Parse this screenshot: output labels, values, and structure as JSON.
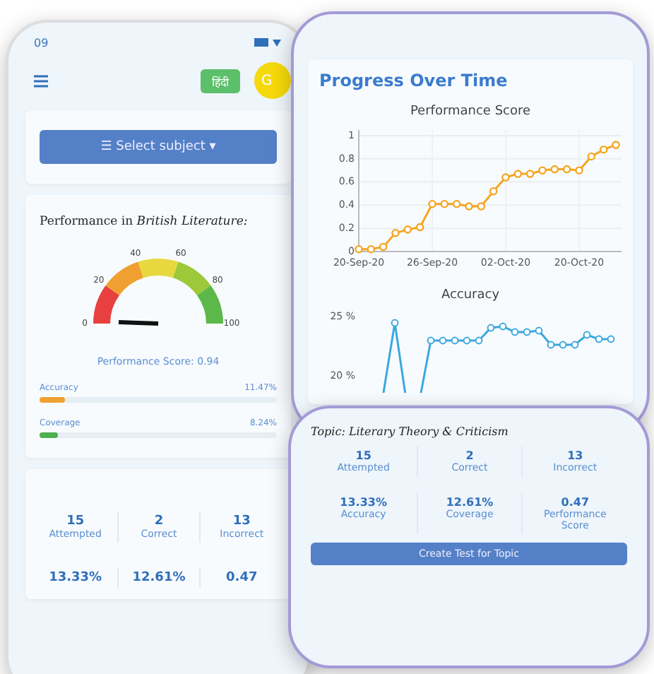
{
  "left_phone": {
    "status_time": "09",
    "language_button": "हिंदी",
    "avatar": "G",
    "subject_button": "Select subject",
    "subject_icon": "☰",
    "subject_caret": "▾",
    "title_prefix": "Performance in ",
    "subject": "British Literature:",
    "gauge": {
      "ticks": [
        "0",
        "20",
        "40",
        "60",
        "80",
        "100"
      ],
      "caption": "Performance Score: 0.94"
    },
    "bars": [
      {
        "label": "Accuracy",
        "reading": "11.47%",
        "level": 0.11,
        "color": "#f0a030"
      },
      {
        "label": "Coverage",
        "reading": "8.24%",
        "level": 0.08,
        "color": "#4cb050"
      }
    ],
    "stats": [
      {
        "value": "15",
        "label": "Attempted"
      },
      {
        "value": "2",
        "label": "Correct"
      },
      {
        "value": "13",
        "label": "Incorrect"
      },
      {
        "value": "13.33%"
      },
      {
        "value": "12.61%"
      },
      {
        "value": "0.47"
      }
    ]
  },
  "right_phone": {
    "title": "Progress Over Time",
    "charts": [
      {
        "chart_data": {
          "type": "line",
          "title": "Performance Score",
          "categories": [
            "20-Sep-20",
            null,
            null,
            null,
            null,
            null,
            "26-Sep-20",
            null,
            null,
            null,
            null,
            null,
            "02-Oct-20",
            null,
            null,
            null,
            null,
            null,
            "20-Oct-20",
            null,
            null,
            null
          ],
          "yticks": [
            0,
            0.2,
            0.4,
            0.6,
            0.8,
            1
          ],
          "ylim": [
            0,
            1
          ],
          "grid": true,
          "series": [
            {
              "color": "#f5a623",
              "marker": "o",
              "values": [
                0.02,
                0.02,
                0.04,
                0.16,
                0.19,
                0.21,
                0.41,
                0.41,
                0.41,
                0.39,
                0.39,
                0.52,
                0.64,
                0.67,
                0.67,
                0.7,
                0.71,
                0.71,
                0.7,
                0.82,
                0.88,
                0.92
              ]
            }
          ]
        }
      }
    ],
    "accuracy": {
      "title": "Accuracy",
      "tick_labels": [
        "25 %",
        "20 %"
      ]
    }
  },
  "topic_card": {
    "prefix": "Topic: ",
    "topic": "Literary Theory & Criticism",
    "stats": [
      {
        "value": "15",
        "label": "Attempted"
      },
      {
        "value": "2",
        "label": "Correct"
      },
      {
        "value": "13",
        "label": "Incorrect"
      },
      {
        "value": "13.33%",
        "label": "Accuracy"
      },
      {
        "value": "12.61%",
        "label": "Coverage"
      },
      {
        "value": "0.47",
        "label": "Performance Score"
      }
    ],
    "button": "Create Test for Topic"
  }
}
